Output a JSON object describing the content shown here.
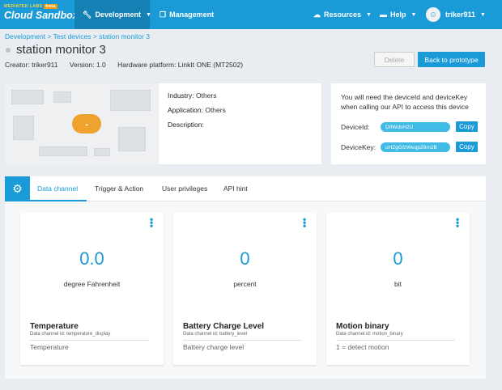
{
  "nav": {
    "brand_top": "MEDIATEK LABS",
    "brand_badge": "beta",
    "brand_name": "Cloud Sandbox",
    "development": "Development",
    "management": "Management",
    "resources": "Resources",
    "help": "Help",
    "user": "triker911"
  },
  "breadcrumb": {
    "development": "Development",
    "test_devices": "Test devices",
    "current": "station monitor 3",
    "separator": ">"
  },
  "device": {
    "title": "station monitor 3",
    "creator": "Creator: triker911",
    "version": "Version: 1.0",
    "platform": "Hardware platform: LinkIt ONE (MT2502)"
  },
  "actions": {
    "delete": "Delete",
    "back": "Back to prototype"
  },
  "info": {
    "industry_label": "Industry:",
    "industry": "Others",
    "application_label": "Application:",
    "application": "Others",
    "description_label": "Description:"
  },
  "keys": {
    "note": "You will need the deviceId and deviceKey when calling our API to access this device",
    "device_id_label": "DeviceId:",
    "device_id": "D0WdsH2U",
    "device_key_label": "DeviceKey:",
    "device_key": "uHZgGfzWeqpZ6m2B",
    "copy": "Copy"
  },
  "tabs": [
    "Data channel",
    "Trigger & Action",
    "User privileges",
    "API hint"
  ],
  "channels": [
    {
      "value": "0.0",
      "unit": "degree Fahrenheit",
      "name": "Temperature",
      "id": "Data channel id: temperature_display",
      "desc": "Temperature"
    },
    {
      "value": "0",
      "unit": "percent",
      "name": "Battery Charge Level",
      "id": "Data channel id: battery_level",
      "desc": "Battery charge level"
    },
    {
      "value": "0",
      "unit": "bit",
      "name": "Motion binary",
      "id": "Data channel id: motion_binary",
      "desc": "1 = detect motion"
    }
  ],
  "colors": {
    "primary": "#1a9ad6",
    "nav_active": "#1580b4",
    "pill": "#3fbbe6"
  },
  "icons": {
    "development": "wrench-icon",
    "management": "copy-icon",
    "resources": "cloud-icon",
    "help": "chat-icon",
    "tab_panel": "gears-icon",
    "channel_menu": "kebab-icon"
  }
}
